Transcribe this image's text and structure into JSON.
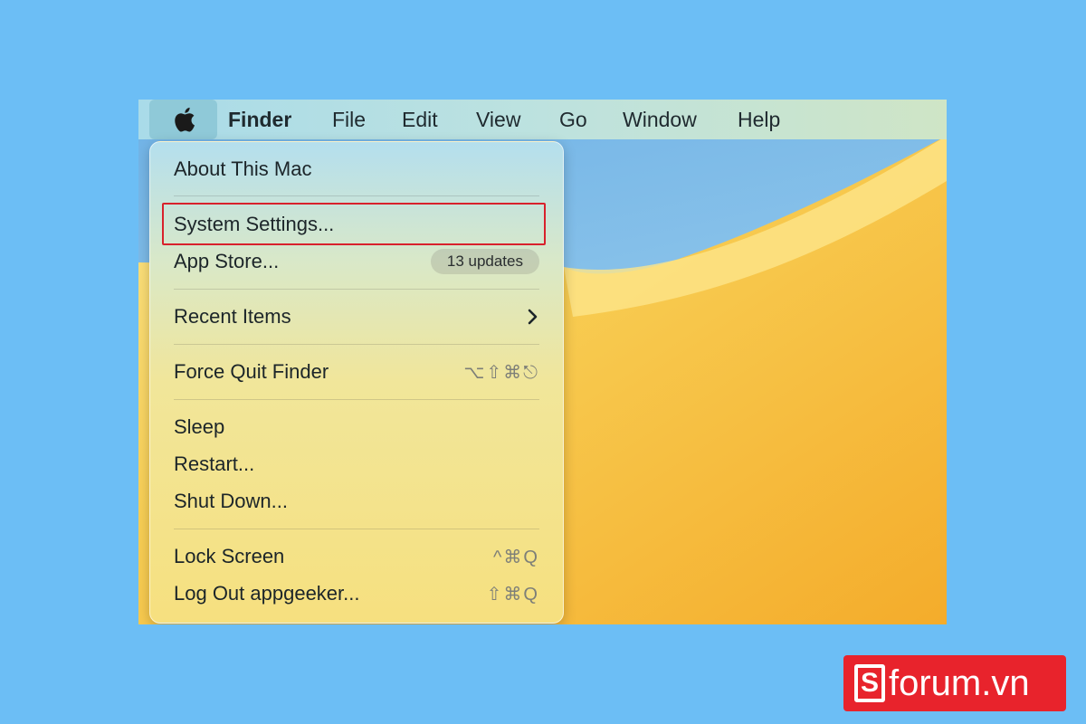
{
  "menubar": {
    "items": [
      {
        "label": "Finder",
        "bold": true
      },
      {
        "label": "File"
      },
      {
        "label": "Edit"
      },
      {
        "label": "View"
      },
      {
        "label": "Go"
      },
      {
        "label": "Window"
      },
      {
        "label": "Help"
      }
    ],
    "apple_icon": "apple-logo-icon"
  },
  "apple_menu": {
    "about": "About This Mac",
    "system_settings": "System Settings...",
    "app_store": "App Store...",
    "app_store_badge": "13 updates",
    "recent_items": "Recent Items",
    "recent_items_icon": "chevron-right-icon",
    "force_quit": "Force Quit Finder",
    "force_quit_shortcut": "⌥⇧⌘⎋",
    "sleep": "Sleep",
    "restart": "Restart...",
    "shut_down": "Shut Down...",
    "lock_screen": "Lock Screen",
    "lock_screen_shortcut": "^⌘Q",
    "log_out": "Log Out appgeeker...",
    "log_out_shortcut": "⇧⌘Q"
  },
  "highlight_color": "#d8212c",
  "watermark": {
    "text": "forum.vn",
    "mark": "S"
  }
}
